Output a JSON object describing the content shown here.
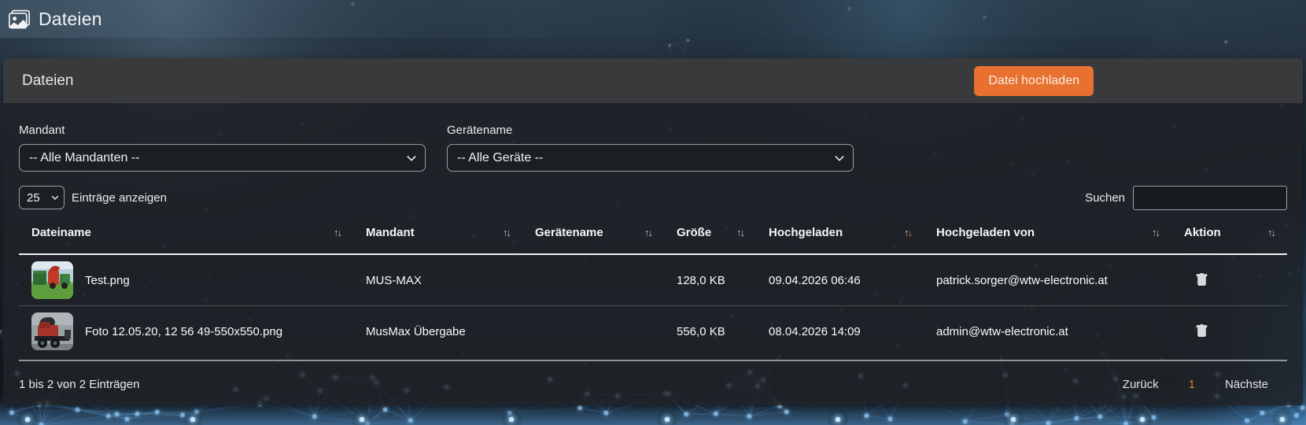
{
  "page": {
    "title": "Dateien"
  },
  "panel": {
    "title": "Dateien",
    "upload_button": "Datei hochladen"
  },
  "filters": {
    "mandant_label": "Mandant",
    "mandant_value": "-- Alle Mandanten --",
    "geraetename_label": "Gerätename",
    "geraetename_value": "-- Alle Geräte --"
  },
  "table_controls": {
    "page_length_value": "25",
    "page_length_label": "Einträge anzeigen",
    "search_label": "Suchen",
    "search_value": ""
  },
  "table": {
    "columns": [
      "Dateiname",
      "Mandant",
      "Gerätename",
      "Größe",
      "Hochgeladen",
      "Hochgeladen von",
      "Aktion"
    ],
    "sorted_column_index": 4,
    "sort_direction": "desc",
    "rows": [
      {
        "thumbnail": "harvester-field-photo",
        "dateiname": "Test.png",
        "mandant": "MUS-MAX",
        "geraetename": "",
        "groesse": "128,0 KB",
        "hochgeladen": "09.04.2026 06:46",
        "hochgeladen_von": "patrick.sorger@wtw-electronic.at"
      },
      {
        "thumbnail": "wood-chipper-photo",
        "dateiname": "Foto 12.05.20, 12 56 49-550x550.png",
        "mandant": "MusMax Übergabe",
        "geraetename": "",
        "groesse": "556,0 KB",
        "hochgeladen": "08.04.2026 14:09",
        "hochgeladen_von": "admin@wtw-electronic.at"
      }
    ]
  },
  "footer": {
    "info": "1 bis 2 von 2 Einträgen",
    "prev": "Zurück",
    "current_page": "1",
    "next": "Nächste"
  },
  "icons": {
    "app": "images-icon",
    "select": "chevron-down-icon",
    "sort": "sort-arrows-icon",
    "delete": "trash-icon"
  },
  "colors": {
    "accent_orange": "#e8712f",
    "sort_active": "#e0722d",
    "page_current": "#d9822f",
    "background_base": "#131a22"
  }
}
